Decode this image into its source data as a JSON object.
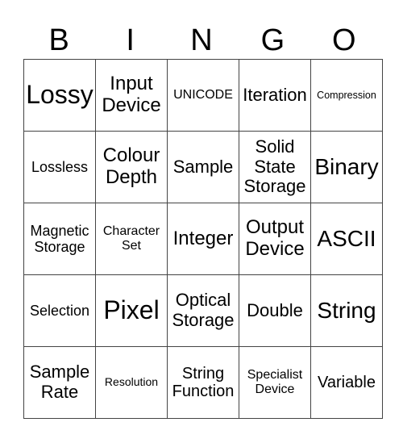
{
  "header": {
    "letters": [
      "B",
      "I",
      "N",
      "G",
      "O"
    ]
  },
  "board": {
    "rows": [
      [
        "Lossy",
        "Input Device",
        "UNICODE",
        "Iteration",
        "Compression"
      ],
      [
        "Lossless",
        "Colour Depth",
        "Sample",
        "Solid State Storage",
        "Binary"
      ],
      [
        "Magnetic Storage",
        "Character Set",
        "Integer",
        "Output Device",
        "ASCII"
      ],
      [
        "Selection",
        "Pixel",
        "Optical Storage",
        "Double",
        "String"
      ],
      [
        "Sample Rate",
        "Resolution",
        "String Function",
        "Specialist Device",
        "Variable"
      ]
    ]
  }
}
